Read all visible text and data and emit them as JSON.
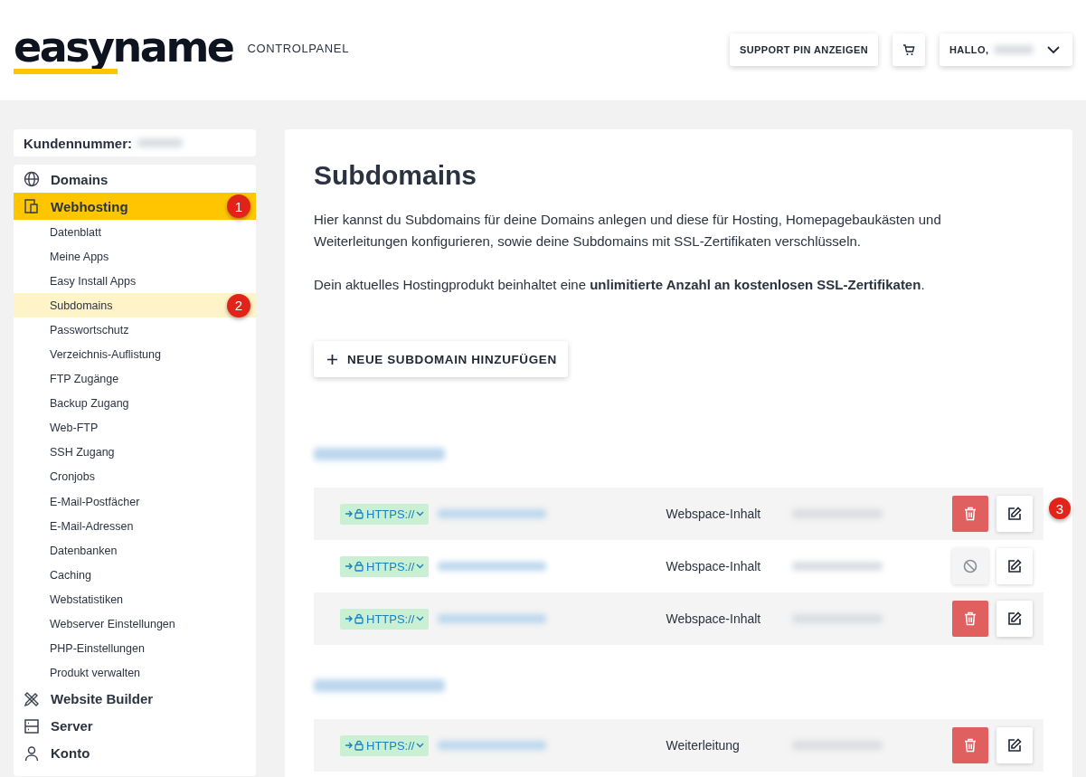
{
  "header": {
    "logo": "easyname",
    "subtitle": "CONTROLPANEL",
    "support_button": "SUPPORT PIN ANZEIGEN",
    "user_menu": {
      "greeting": "HALLO,"
    }
  },
  "sidebar": {
    "customer_label": "Kundennummer:",
    "items": [
      {
        "label": "Domains",
        "selected": false
      },
      {
        "label": "Webhosting",
        "selected": true,
        "marker": "1",
        "children": [
          {
            "label": "Datenblatt",
            "selected": false
          },
          {
            "label": "Meine Apps",
            "selected": false
          },
          {
            "label": "Easy Install Apps",
            "selected": false
          },
          {
            "label": "Subdomains",
            "selected": true,
            "marker": "2"
          },
          {
            "label": "Passwortschutz",
            "selected": false
          },
          {
            "label": "Verzeichnis-Auflistung",
            "selected": false
          },
          {
            "label": "FTP Zugänge",
            "selected": false
          },
          {
            "label": "Backup Zugang",
            "selected": false
          },
          {
            "label": "Web-FTP",
            "selected": false
          },
          {
            "label": "SSH Zugang",
            "selected": false
          },
          {
            "label": "Cronjobs",
            "selected": false
          },
          {
            "label": "E-Mail-Postfächer",
            "selected": false
          },
          {
            "label": "E-Mail-Adressen",
            "selected": false
          },
          {
            "label": "Datenbanken",
            "selected": false
          },
          {
            "label": "Caching",
            "selected": false
          },
          {
            "label": "Webstatistiken",
            "selected": false
          },
          {
            "label": "Webserver Einstellungen",
            "selected": false
          },
          {
            "label": "PHP-Einstellungen",
            "selected": false
          },
          {
            "label": "Produkt verwalten",
            "selected": false
          }
        ]
      },
      {
        "label": "Website Builder",
        "selected": false
      },
      {
        "label": "Server",
        "selected": false
      },
      {
        "label": "Konto",
        "selected": false
      }
    ]
  },
  "main": {
    "title": "Subdomains",
    "intro": "Hier kannst du Subdomains für deine Domains anlegen und diese für Hosting, Homepagebaukästen und Weiterleitungen konfigurieren, sowie deine Subdomains mit SSL-Zertifikaten verschlüsseln.",
    "note": "Dein aktuelles Hostingprodukt beinhaltet eine **unlimitierte Anzahl an kostenlosen SSL-Zertifikaten**.",
    "add_button": "NEUE SUBDOMAIN HINZUFÜGEN",
    "groups": [
      {
        "rows": [
          {
            "protocol": "HTTPS://",
            "type": "Webspace-Inhalt",
            "delete_enabled": true,
            "marker": "3"
          },
          {
            "protocol": "HTTPS://",
            "type": "Webspace-Inhalt",
            "delete_enabled": false
          },
          {
            "protocol": "HTTPS://",
            "type": "Webspace-Inhalt",
            "delete_enabled": true
          }
        ]
      },
      {
        "rows": [
          {
            "protocol": "HTTPS://",
            "type": "Weiterleitung",
            "delete_enabled": true
          }
        ]
      }
    ]
  }
}
